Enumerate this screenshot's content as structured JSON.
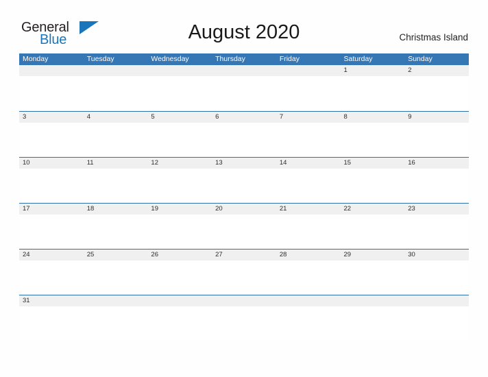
{
  "brand": {
    "word_one": "General",
    "word_two": "Blue",
    "flag_icon": "triangle-flag-icon",
    "color_dark": "#231f20",
    "color_blue": "#1b75bb"
  },
  "header": {
    "title": "August 2020",
    "location": "Christmas Island"
  },
  "colors": {
    "header_blue": "#3576b5",
    "divider_blue": "#2f6fae",
    "band_gray": "#f0f0f0",
    "page_background": "#fefefe",
    "text_dark": "#2b2b2b"
  },
  "calendar": {
    "month": "August",
    "year": "2020",
    "week_start": "Monday",
    "day_headers": [
      "Monday",
      "Tuesday",
      "Wednesday",
      "Thursday",
      "Friday",
      "Saturday",
      "Sunday"
    ],
    "weeks": [
      {
        "days": [
          "",
          "",
          "",
          "",
          "",
          "1",
          "2"
        ]
      },
      {
        "days": [
          "3",
          "4",
          "5",
          "6",
          "7",
          "8",
          "9"
        ]
      },
      {
        "days": [
          "10",
          "11",
          "12",
          "13",
          "14",
          "15",
          "16"
        ]
      },
      {
        "days": [
          "17",
          "18",
          "19",
          "20",
          "21",
          "22",
          "23"
        ]
      },
      {
        "days": [
          "24",
          "25",
          "26",
          "27",
          "28",
          "29",
          "30"
        ]
      },
      {
        "days": [
          "31",
          "",
          "",
          "",
          "",
          "",
          ""
        ]
      }
    ]
  }
}
